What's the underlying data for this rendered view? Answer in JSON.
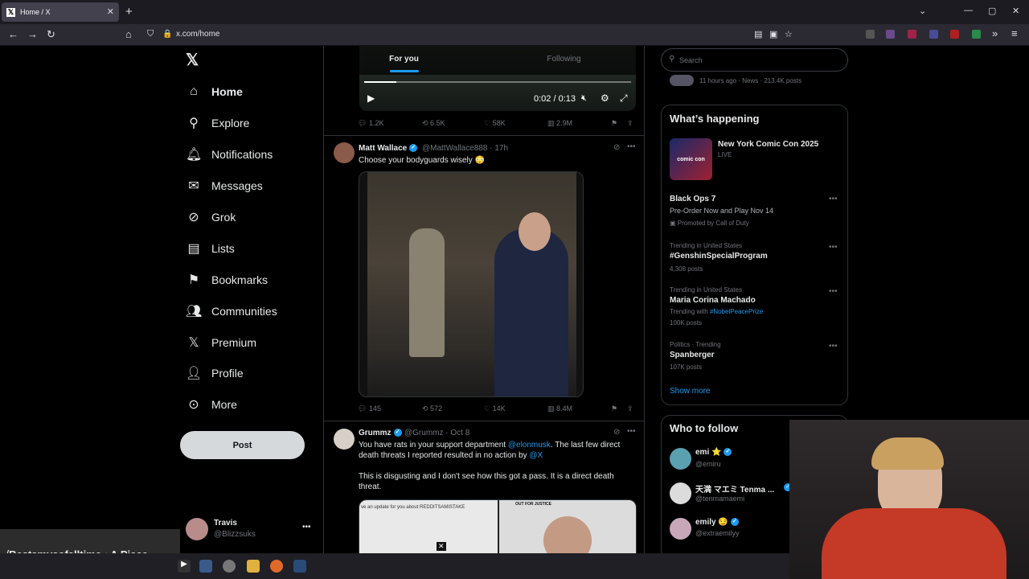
{
  "browser": {
    "tab_title": "Home / X",
    "url": "x.com/home"
  },
  "sidebar": {
    "items": [
      {
        "label": "Home",
        "icon": "home-icon"
      },
      {
        "label": "Explore",
        "icon": "search-icon"
      },
      {
        "label": "Notifications",
        "icon": "bell-icon"
      },
      {
        "label": "Messages",
        "icon": "envelope-icon"
      },
      {
        "label": "Grok",
        "icon": "grok-icon"
      },
      {
        "label": "Lists",
        "icon": "list-icon"
      },
      {
        "label": "Bookmarks",
        "icon": "bookmark-icon"
      },
      {
        "label": "Communities",
        "icon": "people-icon"
      },
      {
        "label": "Premium",
        "icon": "x-icon"
      },
      {
        "label": "Profile",
        "icon": "person-icon"
      },
      {
        "label": "More",
        "icon": "more-circle-icon"
      }
    ],
    "post_label": "Post",
    "account": {
      "name": "Travis",
      "handle": "@Blizzsuks"
    }
  },
  "feed": {
    "tabs": [
      "For you",
      "Following"
    ],
    "video1": {
      "time": "0:02 / 0:13"
    },
    "tweet0_actions": {
      "replies": "1.2K",
      "reposts": "6.5K",
      "likes": "58K",
      "views": "2.9M"
    },
    "tweet1": {
      "name": "Matt Wallace",
      "handle": "@MattWallace888",
      "time": "· 17h",
      "text": "Choose your bodyguards wisely 😳",
      "actions": {
        "replies": "145",
        "reposts": "572",
        "likes": "14K",
        "views": "8.4M"
      }
    },
    "tweet2": {
      "name": "Grummz",
      "handle": "@Grummz",
      "time": "· Oct 8",
      "text_a": "You have rats in your support department ",
      "mention1": "@elonmusk",
      "text_b": ". The last few direct death threats I reported resulted in no action by ",
      "mention2": "@X",
      "text_c": "This is disgusting and I don't see how this got a pass. It is a direct death threat.",
      "img_left_text": "ve an update for you about REDDITSAMISTAKE",
      "img_right_text": "OUT FOR JUSTICE"
    }
  },
  "right": {
    "search_placeholder": "Search",
    "top_item_meta": "11 hours ago · News · 213.4K posts",
    "whats_happening": "What’s happening",
    "event": {
      "title": "New York Comic Con 2025",
      "status": "LIVE",
      "thumb_text": "comic con"
    },
    "trends": [
      {
        "context": "",
        "title": "Black Ops 7",
        "sub": "Pre-Order Now and Play Nov 14",
        "extra": "Promoted by Call of Duty"
      },
      {
        "context": "Trending in United States",
        "title": "#GenshinSpecialProgram",
        "sub": "4,308 posts"
      },
      {
        "context": "Trending in United States",
        "title": "Maria Corina Machado",
        "sub_a": "Trending with ",
        "sub_link": "#NobelPeacePrize",
        "sub2": "100K posts"
      },
      {
        "context": "Politics · Trending",
        "title": "Spanberger",
        "sub": "107K posts"
      }
    ],
    "show_more": "Show more",
    "who_to_follow": "Who to follow",
    "follows": [
      {
        "name": "emi ⭐",
        "handle": "@emiru"
      },
      {
        "name": "天満 マエミ Tenma ...",
        "handle": "@tenmamaemi"
      },
      {
        "name": "emily 😏",
        "handle": "@extraemilyy"
      }
    ]
  },
  "overlay": {
    "ticker": "√Bestamvsofalltime • A Piece..."
  },
  "colors": {
    "accent": "#1d9bf0",
    "bg": "#000000",
    "border": "#2f3336",
    "muted": "#71767b"
  }
}
